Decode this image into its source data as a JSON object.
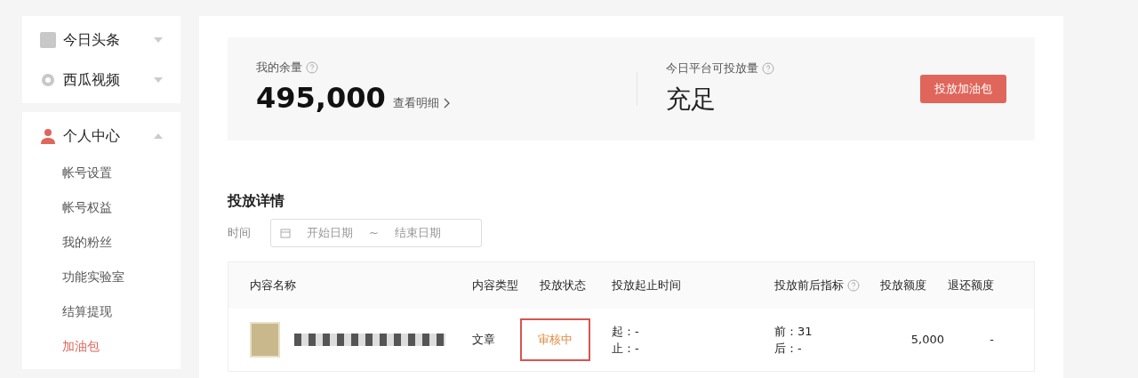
{
  "sidebar": {
    "groups": [
      {
        "label": "今日头条",
        "expanded": false
      },
      {
        "label": "西瓜视频",
        "expanded": false
      },
      {
        "label": "个人中心",
        "expanded": true,
        "items": [
          {
            "label": "帐号设置",
            "selected": false
          },
          {
            "label": "帐号权益",
            "selected": false
          },
          {
            "label": "我的粉丝",
            "selected": false
          },
          {
            "label": "功能实验室",
            "selected": false
          },
          {
            "label": "结算提现",
            "selected": false
          },
          {
            "label": "加油包",
            "selected": true
          }
        ]
      }
    ]
  },
  "summary": {
    "balance_label": "我的余量",
    "balance": "495,000",
    "detail_link": "查看明细",
    "platform_label": "今日平台可投放量",
    "platform_value": "充足",
    "button": "投放加油包"
  },
  "details": {
    "title": "投放详情",
    "date_label": "时间",
    "start_placeholder": "开始日期",
    "separator": "~",
    "end_placeholder": "结束日期"
  },
  "table": {
    "columns": [
      {
        "label": "内容名称"
      },
      {
        "label": "内容类型"
      },
      {
        "label": "投放状态"
      },
      {
        "label": "投放起止时间"
      },
      {
        "label": "投放前后指标",
        "help": true
      },
      {
        "label": "投放额度"
      },
      {
        "label": "退还额度"
      }
    ],
    "rows": [
      {
        "type": "文章",
        "status": "审核中",
        "status_highlighted": true,
        "start": "起：-",
        "end": "止：-",
        "before": "前：31",
        "after": "后：-",
        "amount": "5,000",
        "refund": "-"
      }
    ]
  }
}
